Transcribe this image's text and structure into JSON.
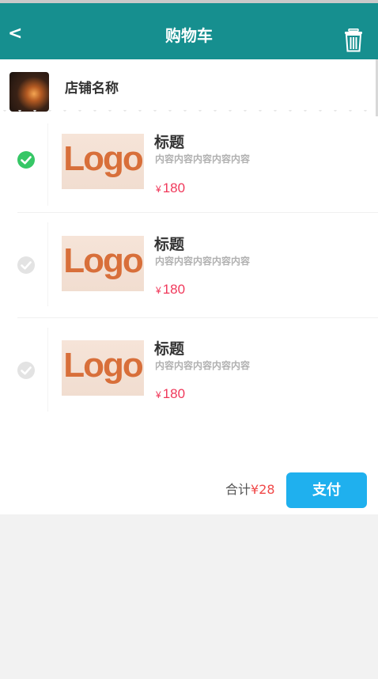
{
  "header": {
    "back_label": "<",
    "title": "购物车",
    "trash_icon": "trash-icon"
  },
  "shop": {
    "name": "店铺名称"
  },
  "items": [
    {
      "title": "标题",
      "desc": "内容内容内容内容内容",
      "currency": "¥",
      "price": "180",
      "checked": true,
      "image_text": "Logo"
    },
    {
      "title": "标题",
      "desc": "内容内容内容内容内容",
      "currency": "¥",
      "price": "180",
      "checked": false,
      "image_text": "Logo"
    },
    {
      "title": "标题",
      "desc": "内容内容内容内容内容",
      "currency": "¥",
      "price": "180",
      "checked": false,
      "image_text": "Logo"
    }
  ],
  "footer": {
    "total_label": "合计",
    "total_amount": "¥28",
    "pay_label": "支付"
  },
  "colors": {
    "header_bg": "#168f8f",
    "pay_button": "#1fb0ee",
    "price": "#f0385a",
    "checked": "#36c766",
    "unchecked": "#e3e3e3"
  }
}
